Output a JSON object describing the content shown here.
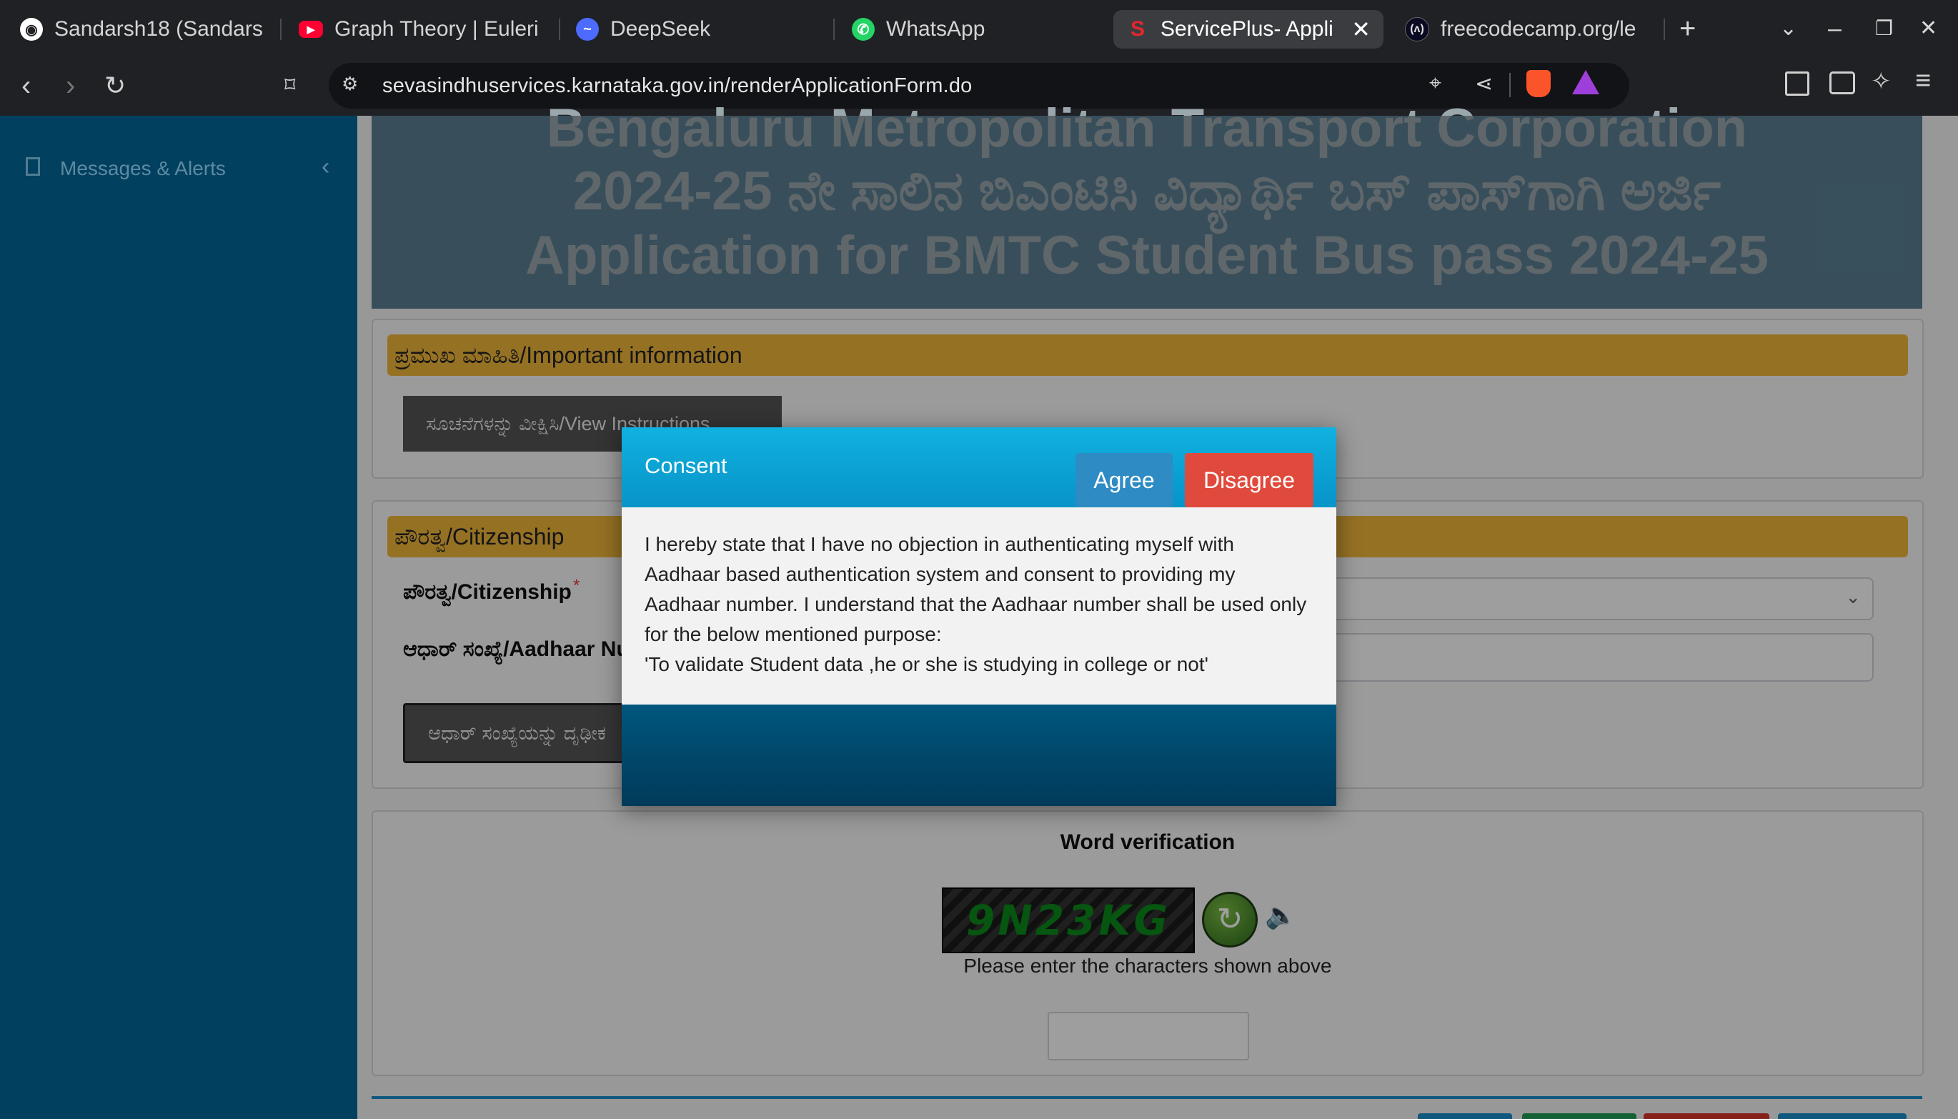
{
  "tabs": [
    {
      "title": "Sandarsh18 (Sandarsh",
      "icon": "github-icon"
    },
    {
      "title": "Graph Theory | Euleri",
      "icon": "youtube-icon"
    },
    {
      "title": "DeepSeek",
      "icon": "deepseek-icon"
    },
    {
      "title": "WhatsApp",
      "icon": "whatsapp-icon"
    },
    {
      "title": "ServicePlus- Appli",
      "icon": "serviceplus-icon",
      "active": true
    },
    {
      "title": "freecodecamp.org/le",
      "icon": "freecodecamp-icon"
    }
  ],
  "address_bar": {
    "url": "sevasindhuservices.karnataka.gov.in/renderApplicationForm.do"
  },
  "sidebar": {
    "item": "Messages & Alerts"
  },
  "banner": {
    "line1": "Bengaluru Metropolitan Transport Corporation",
    "line2": "2024-25 ನೇ ಸಾಲಿನ ಬಿಎಂಟಿಸಿ ವಿದ್ಯಾರ್ಥಿ ಬಸ್ ಪಾಸ್‌ಗಾಗಿ ಅರ್ಜಿ",
    "line3": "Application for BMTC Student Bus pass 2024-25"
  },
  "important": {
    "heading": "ಪ್ರಮುಖ ಮಾಹಿತಿ/Important information",
    "view_button": "ಸೂಚನೆಗಳನ್ನು ವೀಕ್ಷಿಸಿ/View Instructions"
  },
  "citizenship": {
    "heading": "ಪೌರತ್ವ/Citizenship",
    "citizenship_label": "ಪೌರತ್ವ/Citizenship",
    "required_mark": "*",
    "aadhaar_label": "ಆಧಾರ್ ಸಂಖ್ಯೆ/Aadhaar Nu",
    "verify_button": "ಆಧಾರ್ ಸಂಖ್ಯೆಯನ್ನು ದೃಢೀಕ"
  },
  "word_verification": {
    "heading": "Word verification",
    "captcha": "9N23KG",
    "hint": "Please enter the characters shown above"
  },
  "modal": {
    "title": "Consent",
    "body_lines": [
      "I hereby state that I have no objection in authenticating myself with",
      "Aadhaar based authentication system and consent to providing my",
      "Aadhaar number. I understand that the Aadhaar number shall be used only",
      "for the below mentioned purpose:",
      "'To validate Student data ,he or she is studying in college or not'"
    ],
    "agree": "Agree",
    "disagree": "Disagree"
  },
  "colors": {
    "modal_header": "#0fa9dc",
    "agree": "#2e8bc4",
    "disagree": "#e04a3c",
    "sidebar": "#02405f",
    "section_bar": "#f0b73b"
  }
}
